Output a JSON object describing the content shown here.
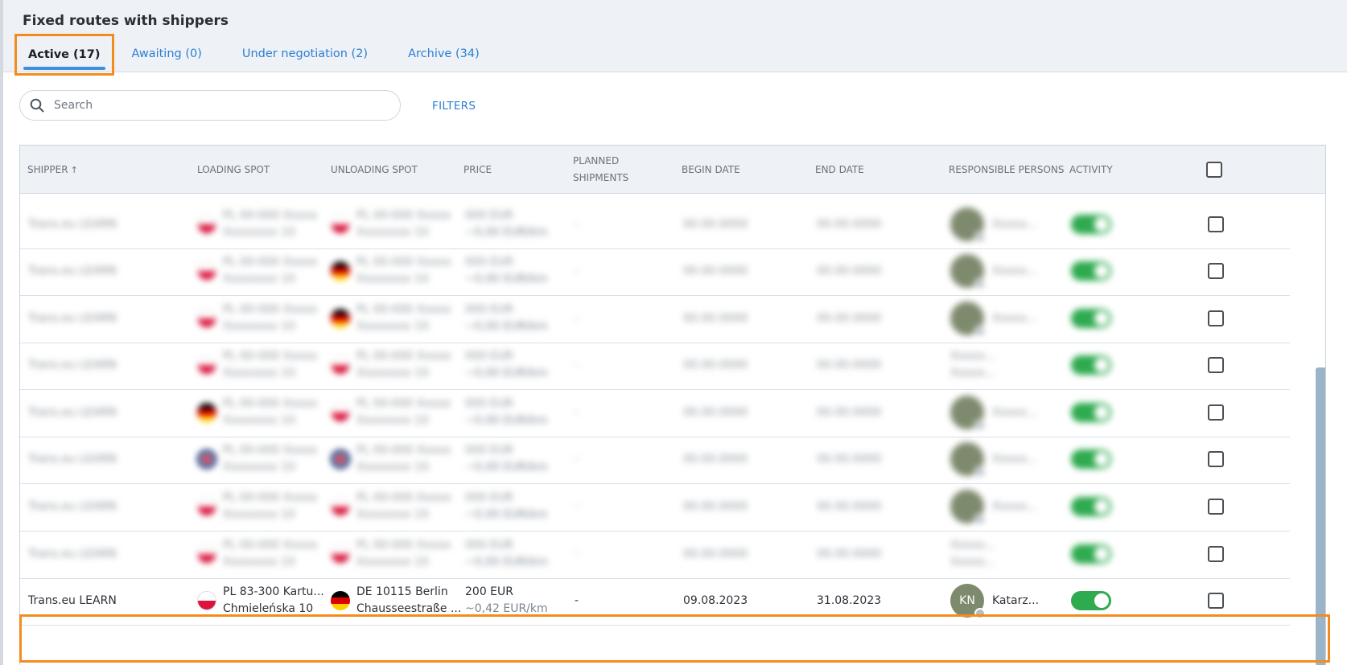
{
  "page": {
    "title": "Fixed routes with shippers"
  },
  "tabs": [
    {
      "label": "Active (17)",
      "active": true
    },
    {
      "label": "Awaiting (0)",
      "active": false
    },
    {
      "label": "Under negotiation (2)",
      "active": false
    },
    {
      "label": "Archive (34)",
      "active": false
    }
  ],
  "search": {
    "placeholder": "Search",
    "icon": "search-icon"
  },
  "filters_label": "FILTERS",
  "table": {
    "columns": {
      "shipper": "SHIPPER",
      "loading": "LOADING SPOT",
      "unloading": "UNLOADING SPOT",
      "price": "PRICE",
      "planned_1": "PLANNED",
      "planned_2": "SHIPMENTS",
      "begin": "BEGIN DATE",
      "end": "END DATE",
      "responsible": "RESPONSIBLE PERSONS",
      "activity": "ACTIVITY"
    },
    "sort_indicator": "↑",
    "blurred_row": {
      "shipper": "Trans.eu LEARN",
      "spot_line1": "PL 00-000 Xxxxx",
      "spot_line2": "Xxxxxxxx 10",
      "price_line1": "000 EUR",
      "price_line2": "~0,00 EUR/km",
      "planned": "-",
      "date": "00.00.0000",
      "person": "Xxxxx..."
    },
    "visible_row": {
      "shipper": "Trans.eu LEARN",
      "loading_line1": "PL 83-300 Kartu...",
      "loading_line2": "Chmieleńska 10",
      "unloading_line1": "DE 10115 Berlin",
      "unloading_line2": "Chausseestraße ...",
      "price_line1": "200 EUR",
      "price_line2": "~0,42 EUR/km",
      "planned": "-",
      "begin": "09.08.2023",
      "end": "31.08.2023",
      "avatar_initials": "KN",
      "person": "Katarz..."
    }
  },
  "colors": {
    "accent_blue": "#2b7fd6",
    "highlight_orange": "#f28c1f",
    "toggle_green": "#2eaa4f",
    "header_bg": "#eef1f5"
  }
}
